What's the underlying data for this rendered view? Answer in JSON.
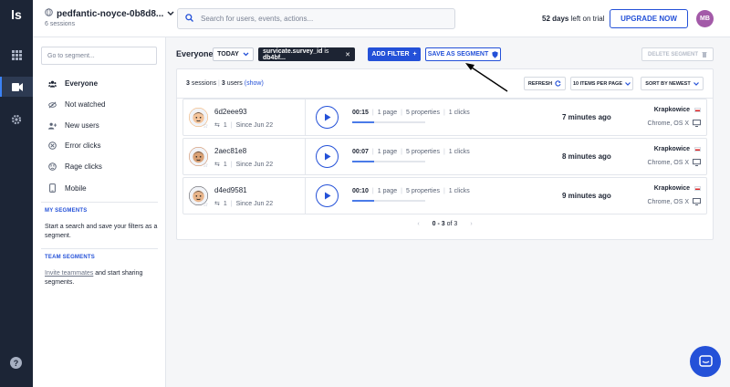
{
  "project": {
    "name": "pedfantic-noyce-0b8d8...",
    "sessions_count": "6 sessions"
  },
  "search": {
    "placeholder": "Search for users, events, actions..."
  },
  "trial": {
    "days": "52 days",
    "suffix": "left on trial"
  },
  "upgrade_label": "UPGRADE NOW",
  "user_initials": "MB",
  "sidebar": {
    "search_placeholder": "Go to segment...",
    "items": [
      {
        "label": "Everyone",
        "icon": "people-icon"
      },
      {
        "label": "Not watched",
        "icon": "eye-off-icon"
      },
      {
        "label": "New users",
        "icon": "user-plus-icon"
      },
      {
        "label": "Error clicks",
        "icon": "error-icon"
      },
      {
        "label": "Rage clicks",
        "icon": "rage-icon"
      },
      {
        "label": "Mobile",
        "icon": "mobile-icon"
      }
    ],
    "my_segments_title": "MY SEGMENTS",
    "my_segments_text": "Start a search and save your filters as a segment.",
    "team_segments_title": "TEAM SEGMENTS",
    "team_link": "Invite teammates",
    "team_text": " and start sharing segments."
  },
  "filterbar": {
    "segment_name": "Everyone",
    "date_label": "TODAY",
    "chip_key": "survicate.survey_id",
    "chip_op": "is",
    "chip_value": "db4bf...",
    "add_filter": "ADD FILTER",
    "save_segment": "SAVE AS SEGMENT",
    "delete_segment": "DELETE SEGMENT"
  },
  "list_header": {
    "sessions_num": "3",
    "sessions_word": "sessions",
    "users_num": "3",
    "users_word": "users",
    "show_link": "(show)",
    "refresh": "REFRESH",
    "per_page": "10 ITEMS PER PAGE",
    "sort": "SORT BY NEWEST"
  },
  "sessions": [
    {
      "user_id": "6d2eee93",
      "visits": "1",
      "since": "Since Jun 22",
      "duration": "00:15",
      "pages": "1 page",
      "properties": "5 properties",
      "clicks": "1 clicks",
      "progress": 0.3,
      "time_ago": "7 minutes ago",
      "city": "Krapkowice",
      "device": "Chrome, OS X",
      "avatar_color": "#f2a65a"
    },
    {
      "user_id": "2aec81e8",
      "visits": "1",
      "since": "Since Jun 22",
      "duration": "00:07",
      "pages": "1 page",
      "properties": "5 properties",
      "clicks": "1 clicks",
      "progress": 0.3,
      "time_ago": "8 minutes ago",
      "city": "Krapkowice",
      "device": "Chrome, OS X",
      "avatar_color": "#c97b4a"
    },
    {
      "user_id": "d4ed9581",
      "visits": "1",
      "since": "Since Jun 22",
      "duration": "00:10",
      "pages": "1 page",
      "properties": "5 properties",
      "clicks": "1 clicks",
      "progress": 0.3,
      "time_ago": "9 minutes ago",
      "city": "Krapkowice",
      "device": "Chrome, OS X",
      "avatar_color": "#3f3f46"
    }
  ],
  "pagination": {
    "range": "0 - 3",
    "of": "of 3"
  },
  "colors": {
    "accent": "#2451d8",
    "rail": "#1c2536"
  }
}
